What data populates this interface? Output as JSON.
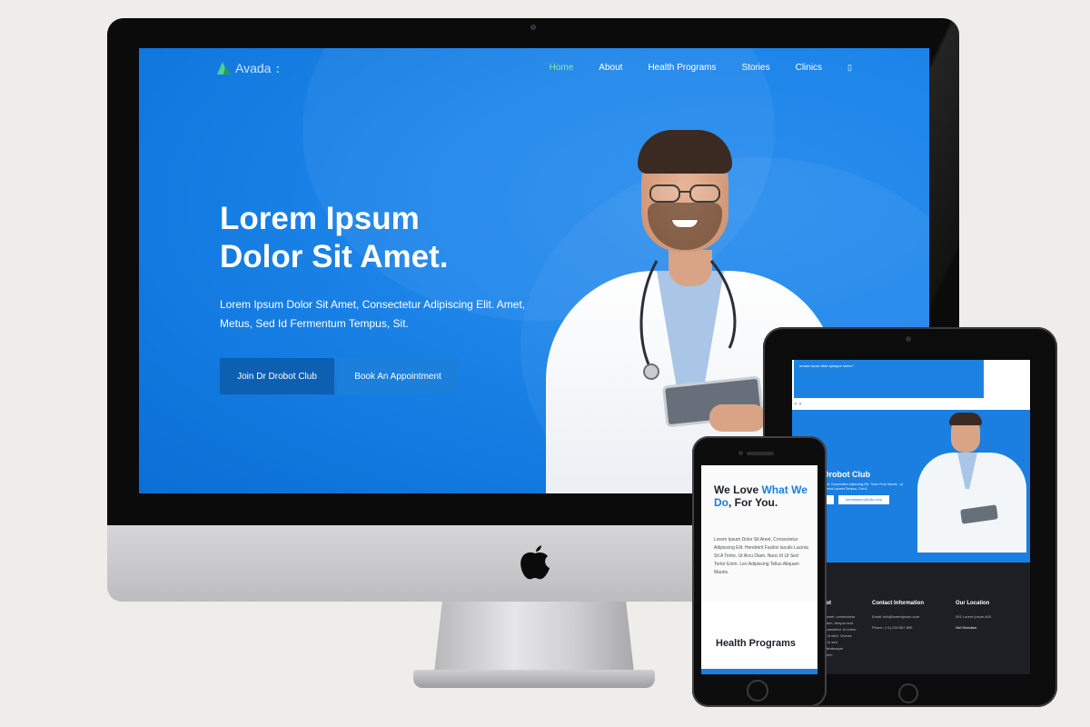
{
  "desktop": {
    "brand": {
      "name": "Avada",
      "suffix": ":"
    },
    "nav": {
      "items": [
        {
          "label": "Home",
          "active": true
        },
        {
          "label": "About",
          "active": false
        },
        {
          "label": "Health Programs",
          "active": false
        },
        {
          "label": "Stories",
          "active": false
        },
        {
          "label": "Clinics",
          "active": false
        }
      ],
      "search_glyph": "▯"
    },
    "hero": {
      "title_line1": "Lorem Ipsum",
      "title_line2": "Dolor Sit Amet.",
      "subtitle": "Lorem Ipsum Dolor Sit Amet, Consectetur Adipiscing Elit. Amet, Metus, Sed Id Fermentum Tempus, Sit.",
      "primary_button": "Join Dr Drobot Club",
      "secondary_button": "Book An Appointment"
    }
  },
  "tablet": {
    "testimonial_fragment": "ornare lacus vitae quisque lorem.\"",
    "slider_dots": "● ●",
    "club_title": "Drobot Club",
    "club_text": "...ed, Consectetur Adipiscing Elit. Tortor Proin Mauris ...ip Viverra Laoreet Tempus, Orci A.",
    "email_pill": "loremipsum@info.com",
    "footer": {
      "col1_title": "obot",
      "col1_text": [
        "...ol amet, consectetur",
        "...entum, tempor and",
        "...consectetur. In lorem",
        "...ou id nibh. Viverra",
        "...ut. In sed",
        "...pellentesque",
        "Laoreet."
      ],
      "contact_title": "Contact Information",
      "contact_email": "Email: info@loremipsum.com",
      "contact_phone": "Phone: (+1) 234 567 890",
      "location_title": "Our Location",
      "location_address": "091 Lorem Ipsum #43",
      "location_link": "Get Direction"
    }
  },
  "phone": {
    "title_pre": "We Love ",
    "title_highlight": "What We Do",
    "title_post": ", For You.",
    "body": "Lorem Ipsum Dolor Sit Amet, Consectetur Adipiscing Elit. Hendrerit Facilisi Iaculis Lacinia Sit A Tortor, Ut Arcu Diam. Nunc Id Ut Sed Tortor Enim. Leo Adipiscing Tellus Aliquam Mauris.",
    "section_heading": "Health Programs"
  },
  "colors": {
    "hero_blue": "#1a7fe0",
    "primary_button": "#0c5fb1",
    "active_nav": "#8fe4b4",
    "footer_dark": "#1d1f24"
  }
}
